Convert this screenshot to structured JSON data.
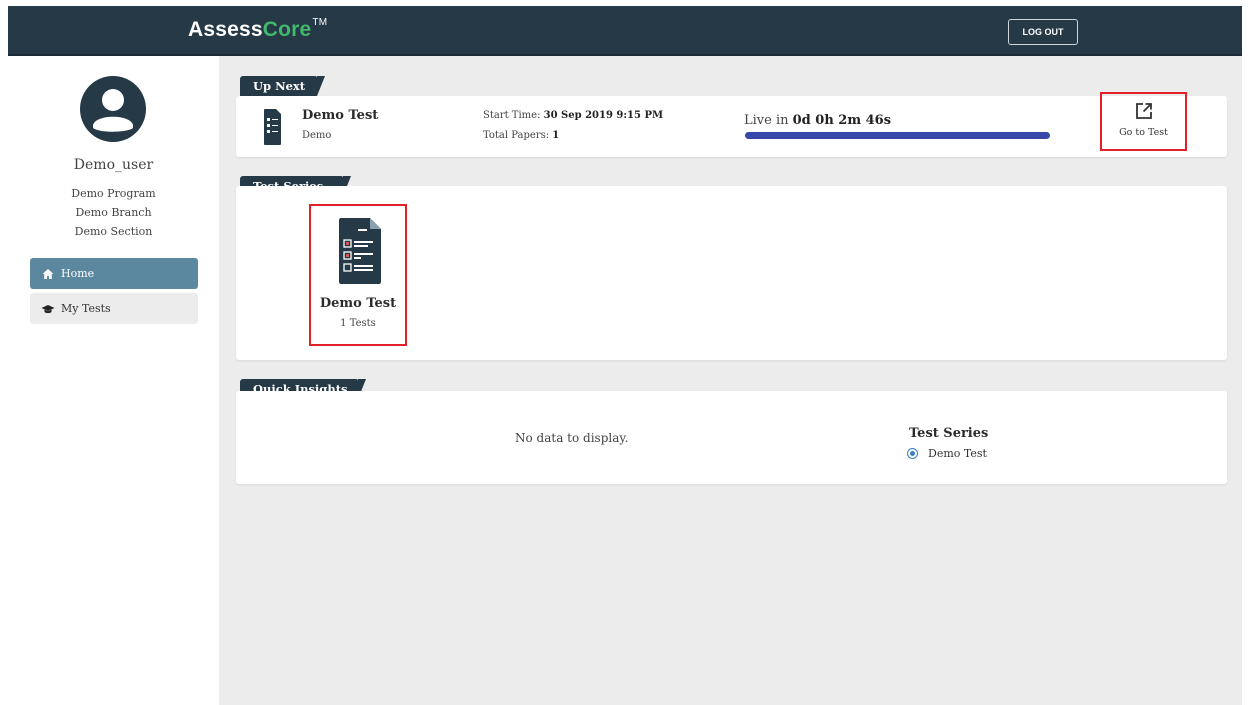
{
  "header": {
    "brand_part1": "Assess",
    "brand_part2": "Core",
    "brand_tm": "TM",
    "logout_label": "LOG OUT"
  },
  "user": {
    "name": "Demo_user",
    "program": "Demo Program",
    "branch": "Demo Branch",
    "section": "Demo Section"
  },
  "nav": {
    "items": [
      {
        "label": "Home",
        "icon": "home-icon",
        "active": true
      },
      {
        "label": "My Tests",
        "icon": "graduation-cap-icon",
        "active": false
      }
    ]
  },
  "up_next": {
    "section_title": "Up Next",
    "test_title": "Demo Test",
    "test_sub": "Demo",
    "start_label": "Start Time: ",
    "start_value": "30 Sep 2019 9:15 PM",
    "papers_label": "Total Papers: ",
    "papers_value": "1",
    "live_label": "Live in ",
    "live_value": "0d 0h 2m 46s",
    "progress_fraction": 1.0,
    "goto_label": "Go to Test"
  },
  "test_series": {
    "section_title": "Test Series",
    "items": [
      {
        "title": "Demo Test",
        "sub": "1 Tests"
      }
    ]
  },
  "quick_insights": {
    "section_title": "Quick Insights",
    "no_data": "No data to display.",
    "legend_title": "Test Series",
    "legend_items": [
      "Demo Test"
    ]
  },
  "colors": {
    "header_bg": "#263947",
    "brand_accent": "#41b86a",
    "nav_active": "#5b879f",
    "progress": "#3649a8",
    "highlight_border": "#e12027"
  }
}
